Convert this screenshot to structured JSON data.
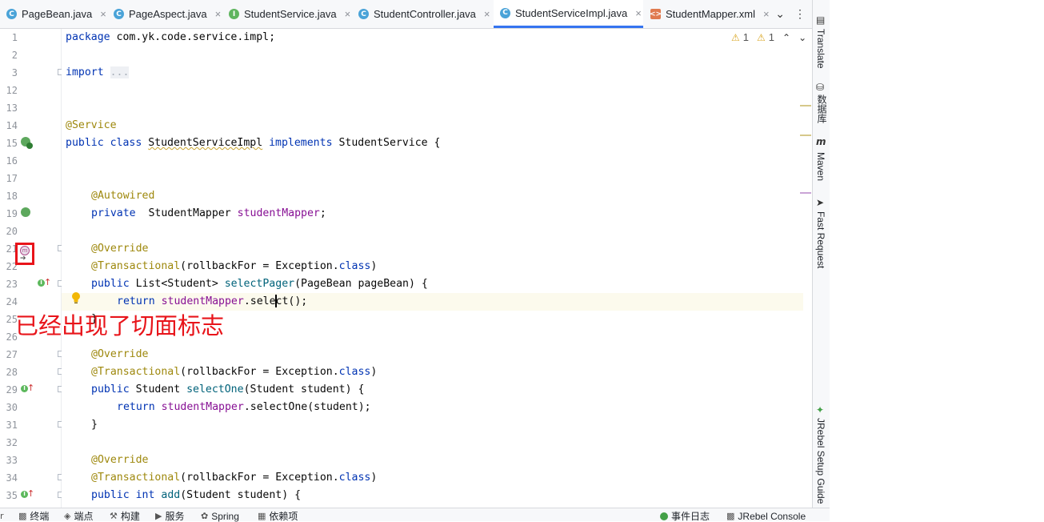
{
  "tabs": [
    {
      "label": "PageBean.java",
      "icon": "class-icon"
    },
    {
      "label": "PageAspect.java",
      "icon": "class-icon"
    },
    {
      "label": "StudentService.java",
      "icon": "interface-icon"
    },
    {
      "label": "StudentController.java",
      "icon": "class-icon"
    },
    {
      "label": "StudentServiceImpl.java",
      "icon": "class-icon",
      "active": true
    },
    {
      "label": "StudentMapper.xml",
      "icon": "xml-file-icon"
    }
  ],
  "tab_close_glyph": "×",
  "inspection": {
    "warnings": "1",
    "weak_warnings": "1"
  },
  "line_numbers": [
    "1",
    "2",
    "3",
    "12",
    "13",
    "14",
    "15",
    "16",
    "17",
    "18",
    "19",
    "20",
    "21",
    "22",
    "23",
    "24",
    "25",
    "26",
    "27",
    "28",
    "29",
    "30",
    "31",
    "32",
    "33",
    "34",
    "35"
  ],
  "code": {
    "l1_kw": "package",
    "l1_rest": " com.yk.code.service.impl;",
    "l3_kw": "import",
    "l3_fold": "...",
    "l14_ann": "@Service",
    "l15_kw1": "public class",
    "l15_cls": "StudentServiceImpl",
    "l15_kw2": "implements",
    "l15_rest": " StudentService {",
    "l18_ann": "@Autowired",
    "l19_kw": "private",
    "l19_type": "  StudentMapper ",
    "l19_fld": "studentMapper",
    "l19_end": ";",
    "ann_override": "@Override",
    "ann_transactional": "@Transactional",
    "trans_args_a": "(rollbackFor = Exception.",
    "trans_args_kw": "class",
    "trans_args_b": ")",
    "l23_kw": "public",
    "l23_a": " List<Student> ",
    "l23_mth": "selectPager",
    "l23_b": "(PageBean pageBean) {",
    "l24_kw": "return",
    "l24_fld": "studentMapper",
    "l24_a": ".sele",
    "l24_b": "ct();",
    "l25": "}",
    "l29_kw": "public",
    "l29_a": " Student ",
    "l29_mth": "selectOne",
    "l29_b": "(Student student) {",
    "l30_kw": "return",
    "l30_fld": "studentMapper",
    "l30_b": ".selectOne(student);",
    "l31": "}",
    "l35_kw1": "public",
    "l35_kw2": "int",
    "l35_mth": "add",
    "l35_b": "(Student student) {"
  },
  "annotation_callout": "已经出现了切面标志",
  "right_tools": [
    "Translate",
    "数据库",
    "Maven",
    "Fast Request",
    "JRebel Setup Guide"
  ],
  "status_left": [
    "终端",
    "端点",
    "构建",
    "服务",
    "Spring",
    "依赖项"
  ],
  "status_right": [
    "事件日志",
    "JRebel Console"
  ],
  "colors": {
    "accent": "#3574f0",
    "callout": "#e8141a",
    "keyword": "#0033b3",
    "annotation": "#9e880d",
    "field": "#871094",
    "method": "#00627a"
  }
}
